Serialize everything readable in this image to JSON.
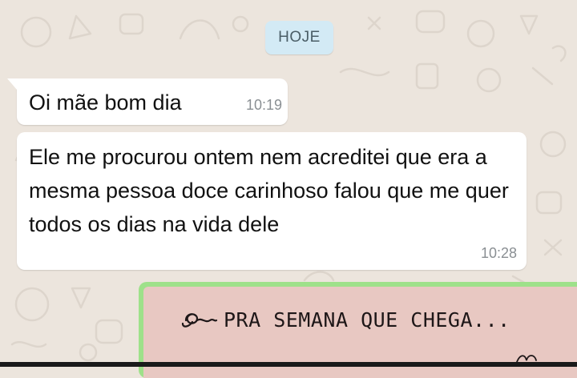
{
  "chat": {
    "date_chip": "HOJE",
    "messages": [
      {
        "text": "Oi mãe bom dia",
        "time": "10:19"
      },
      {
        "text": "Ele me procurou ontem nem acreditei que era a mesma pessoa doce carinhoso falou que me quer todos os dias na vida dele",
        "time": "10:28"
      }
    ],
    "image_message": {
      "caption_text": "PRA SEMANA QUE CHEGA..."
    }
  },
  "colors": {
    "wallpaper": "#ece5dd",
    "bubble_incoming": "#ffffff",
    "date_chip": "#d3eaf5",
    "image_border": "#9ee18a",
    "image_background": "#e8c8c2"
  },
  "icons": {
    "wallpaper": "whatsapp-doodle-pattern",
    "caption_flourish": "swirl-flourish-icon"
  }
}
